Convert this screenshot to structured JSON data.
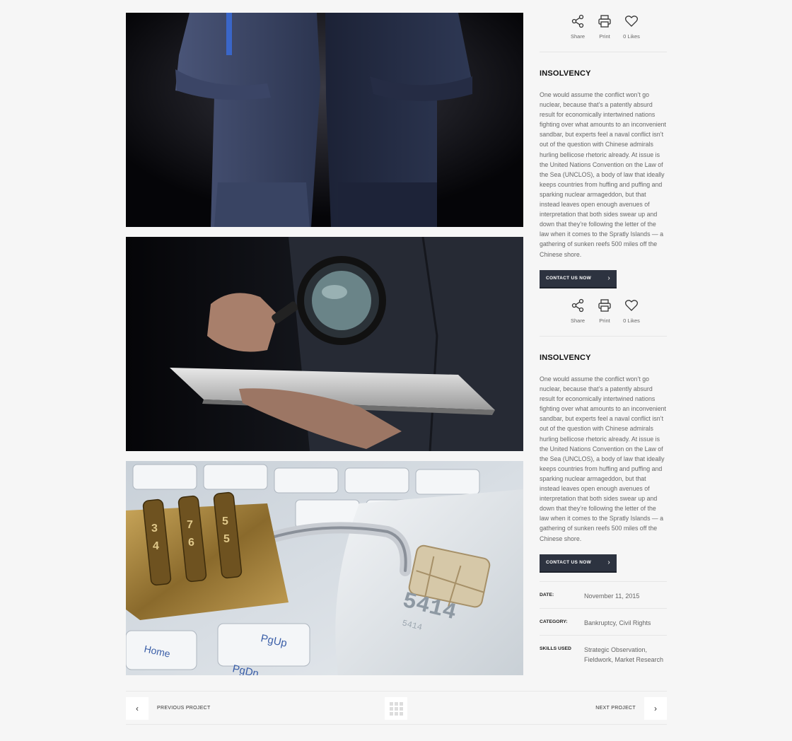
{
  "share_bar": {
    "share_label": "Share",
    "print_label": "Print",
    "likes_label": "0 Likes"
  },
  "blocks": [
    {
      "title": "INSOLVENCY",
      "body": "One would assume the conflict won’t go nuclear, because that’s a patently absurd result for economically intertwined nations fighting over what amounts to an inconvenient sandbar, but experts feel a naval conflict isn’t out of the question with Chinese admirals hurling bellicose rhetoric already. At issue is the United Nations Convention on the Law of the Sea (UNCLOS), a body of law that ideally keeps countries from huffing and puffing and sparking nuclear armageddon, but that instead leaves open enough avenues of interpretation that both sides swear up and down that they’re following the letter of the law when it comes to the Spratly Islands — a gathering of sunken reefs 500 miles off the Chinese shore.",
      "button_label": "CONTACT US NOW"
    },
    {
      "title": "INSOLVENCY",
      "body": "One would assume the conflict won’t go nuclear, because that’s a patently absurd result for economically intertwined nations fighting over what amounts to an inconvenient sandbar, but experts feel a naval conflict isn’t out of the question with Chinese admirals hurling bellicose rhetoric already. At issue is the United Nations Convention on the Law of the Sea (UNCLOS), a body of law that ideally keeps countries from huffing and puffing and sparking nuclear armageddon, but that instead leaves open enough avenues of interpretation that both sides swear up and down that they’re following the letter of the law when it comes to the Spratly Islands — a gathering of sunken reefs 500 miles off the Chinese shore.",
      "button_label": "CONTACT US NOW"
    }
  ],
  "meta": {
    "date_label": "DATE:",
    "date_value": "November 11, 2015",
    "category_label": "CATEGORY:",
    "category_value": "Bankruptcy, Civil Rights",
    "skills_label": "SKILLS USED",
    "skills_value": "Strategic Observation, Fieldwork, Market Research"
  },
  "photos": {
    "p1_icon": "businessmen-suits-image",
    "p2_icon": "magnifying-glass-tablet-image",
    "p3_icon": "padlock-credit-card-keyboard-image",
    "card_number": "5414",
    "card_small_number": "5414",
    "key_home": "Home",
    "key_pgup": "PgUp",
    "key_pgdn": "PgDn"
  },
  "navigation": {
    "prev_label": "PREVIOUS PROJECT",
    "next_label": "NEXT PROJECT",
    "prev_icon": "chevron-left-icon",
    "next_icon": "chevron-right-icon",
    "grid_icon": "grid-icon"
  },
  "colors": {
    "button_bg": "#2d3340",
    "page_bg": "#f6f6f6"
  }
}
